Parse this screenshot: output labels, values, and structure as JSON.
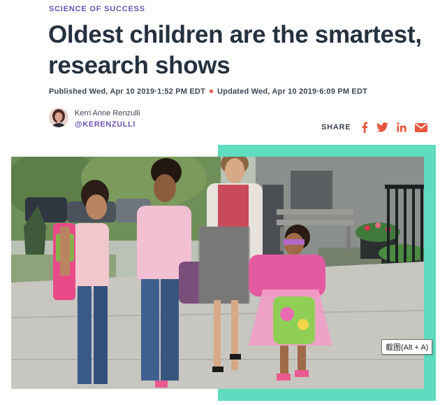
{
  "article": {
    "kicker": "SCIENCE OF SUCCESS",
    "headline": "Oldest children are the smartest, research shows",
    "published": "Published Wed, Apr 10 2019·1:52 PM EDT",
    "updated": "Updated Wed, Apr 10 2019·6:09 PM EDT"
  },
  "author": {
    "name": "Kerri Anne Renzulli",
    "handle": "@KERENZULLI"
  },
  "share": {
    "label": "SHARE",
    "icons": [
      "facebook-icon",
      "twitter-icon",
      "linkedin-icon",
      "email-icon"
    ]
  },
  "tooltip": {
    "text": "截图(Alt + A)"
  },
  "colors": {
    "kicker": "#6b53b6",
    "accent_box": "#5fdcc0",
    "share_icon": "#e8553e",
    "headline": "#25313f"
  }
}
